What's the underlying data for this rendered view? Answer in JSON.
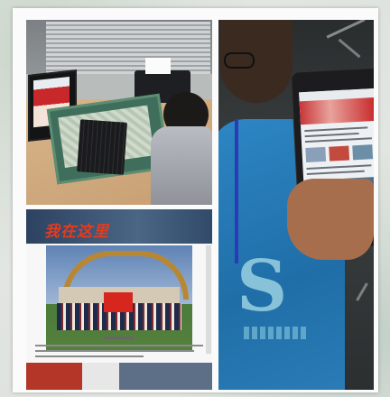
{
  "photos": [
    {
      "name": "office-desk-photo"
    },
    {
      "name": "news-article-photo",
      "banner_title": "我在这里"
    },
    {
      "name": "tablet-photo"
    }
  ],
  "colors": {
    "frame": "#fbfbfb",
    "shirt": "#2d86c4",
    "banner_red": "#e53b1f",
    "flag_red": "#d7261e"
  }
}
